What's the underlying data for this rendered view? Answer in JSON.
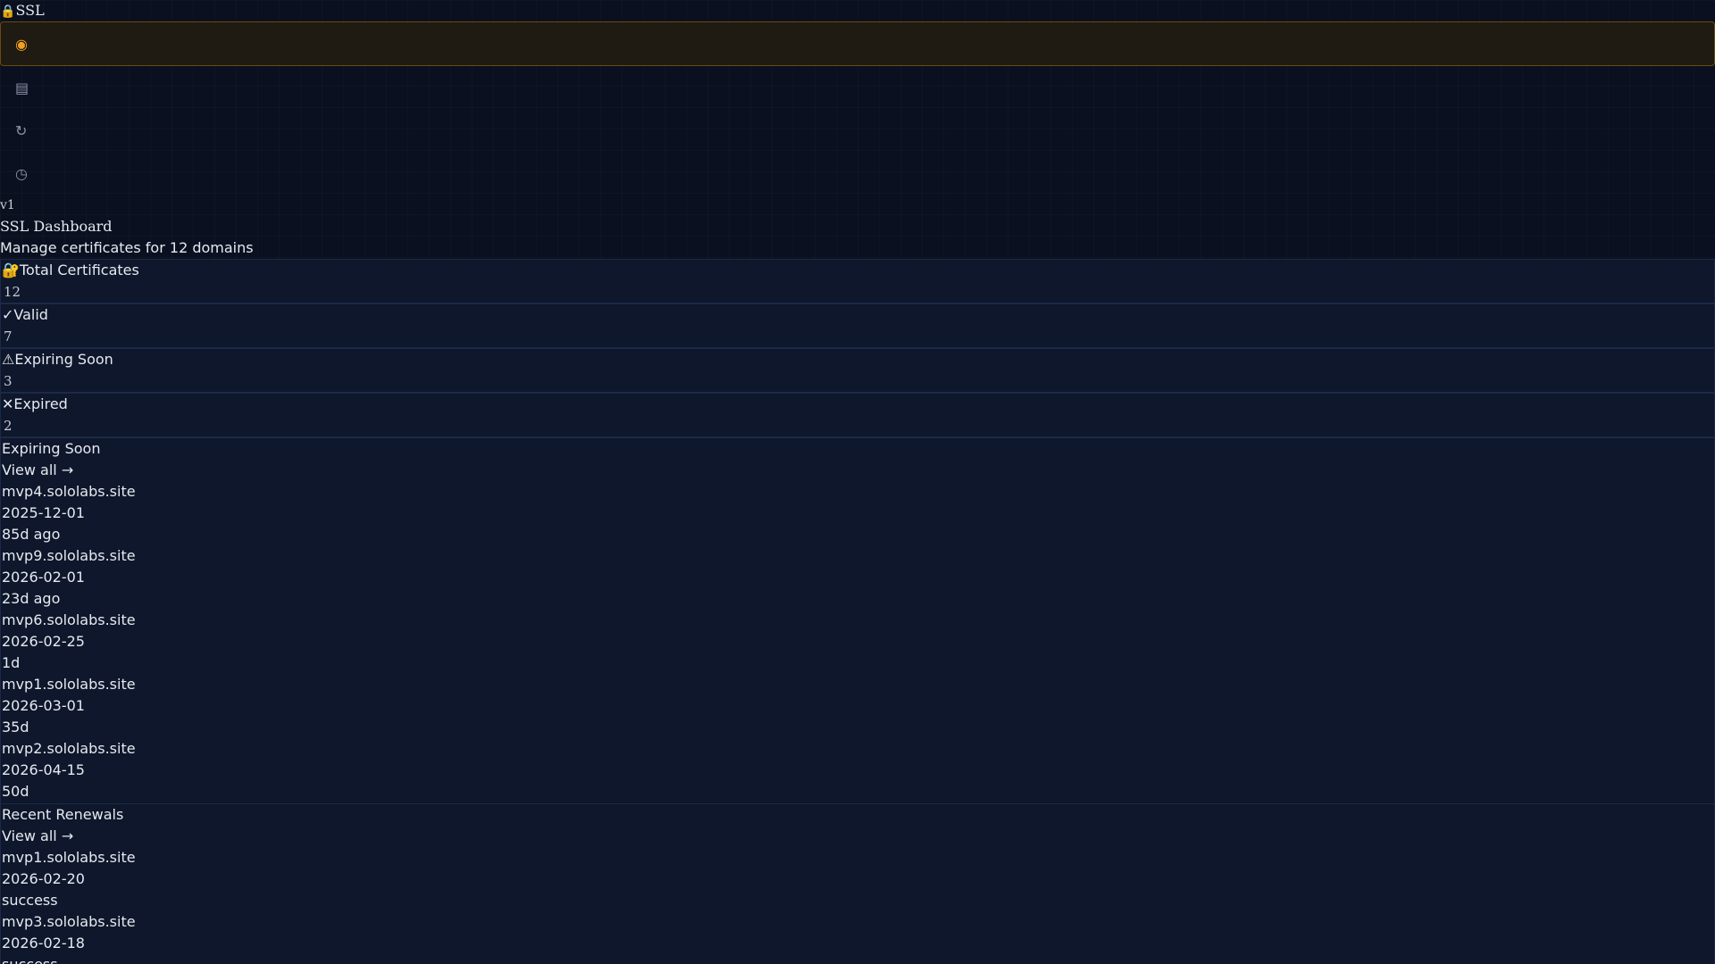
{
  "app": {
    "logo_icon": "lock-icon",
    "logo_glyph": "🔒",
    "name": "SSL",
    "version": "v1"
  },
  "nav": [
    {
      "icon": "radar-icon",
      "glyph": "◉",
      "active": true
    },
    {
      "icon": "list-icon",
      "glyph": "▤",
      "active": false
    },
    {
      "icon": "refresh-icon",
      "glyph": "↻",
      "active": false
    },
    {
      "icon": "clock-icon",
      "glyph": "◷",
      "active": false
    }
  ],
  "header": {
    "title": "SSL Dashboard",
    "subtitle": "Manage certificates for 12 domains"
  },
  "stats": [
    {
      "icon": "lock-key-icon",
      "glyph": "🔐",
      "label": "Total Certificates",
      "value": "12"
    },
    {
      "icon": "check-icon",
      "glyph": "✓",
      "label": "Valid",
      "value": "7"
    },
    {
      "icon": "warning-icon",
      "glyph": "⚠",
      "label": "Expiring Soon",
      "value": "3"
    },
    {
      "icon": "x-icon",
      "glyph": "✕",
      "label": "Expired",
      "value": "2"
    }
  ],
  "expiring": {
    "title": "Expiring Soon",
    "view_all": "View all →",
    "items": [
      {
        "domain": "mvp4.sololabs.site",
        "date": "2025-12-01",
        "remaining": "85d ago"
      },
      {
        "domain": "mvp9.sololabs.site",
        "date": "2026-02-01",
        "remaining": "23d ago"
      },
      {
        "domain": "mvp6.sololabs.site",
        "date": "2026-02-25",
        "remaining": "1d"
      },
      {
        "domain": "mvp1.sololabs.site",
        "date": "2026-03-01",
        "remaining": "35d"
      },
      {
        "domain": "mvp2.sololabs.site",
        "date": "2026-04-15",
        "remaining": "50d"
      }
    ]
  },
  "renewals": {
    "title": "Recent Renewals",
    "view_all": "View all →",
    "items": [
      {
        "domain": "mvp1.sololabs.site",
        "date": "2026-02-20",
        "status": "success"
      },
      {
        "domain": "mvp3.sololabs.site",
        "date": "2026-02-18",
        "status": "success"
      }
    ]
  },
  "colors": {
    "background": "#0b1020",
    "accent": "#f0a020",
    "panel": "#0e172b",
    "border": "#1c2a48"
  }
}
